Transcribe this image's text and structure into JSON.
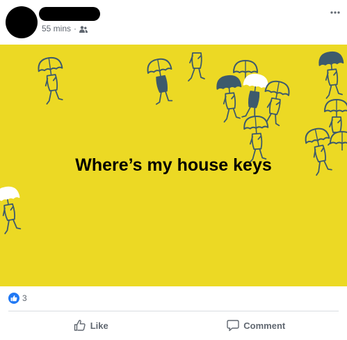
{
  "post": {
    "author": {
      "name": "",
      "avatar_color": "#000000"
    },
    "timestamp": "55 mins",
    "separator": "·",
    "audience_icon": "friends-icon",
    "menu_icon": "more-options-icon",
    "media": {
      "background_color": "#ecd924",
      "umbrella_colors": [
        "#ecd924",
        "#3d5a6c",
        "#ffffff"
      ],
      "caption": "Where’s my house keys"
    },
    "reactions": {
      "icon": "like-icon",
      "count": "3",
      "badge_color": "#2078f4"
    },
    "actions": {
      "like_label": "Like",
      "comment_label": "Comment"
    }
  }
}
